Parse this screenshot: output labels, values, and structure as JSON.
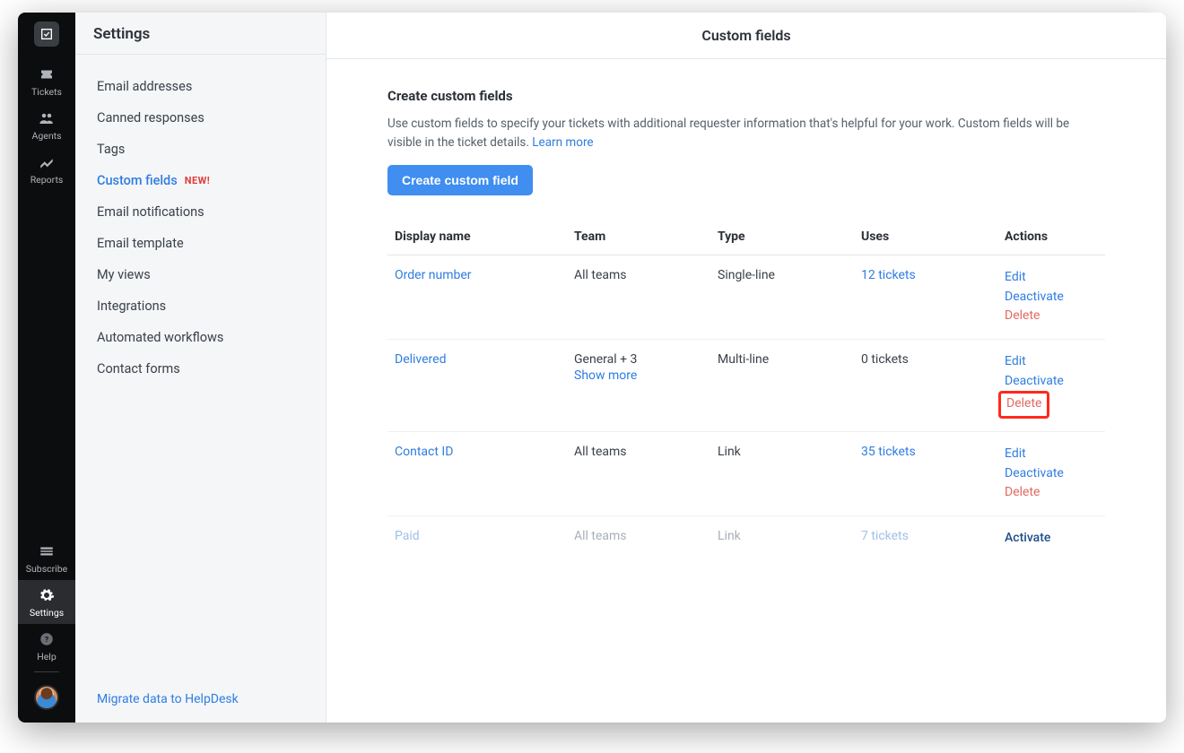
{
  "nav": {
    "items": [
      {
        "label": "Tickets"
      },
      {
        "label": "Agents"
      },
      {
        "label": "Reports"
      }
    ],
    "bottom": [
      {
        "label": "Subscribe"
      },
      {
        "label": "Settings"
      },
      {
        "label": "Help"
      }
    ]
  },
  "sidebar": {
    "title": "Settings",
    "items": [
      {
        "label": "Email addresses"
      },
      {
        "label": "Canned responses"
      },
      {
        "label": "Tags"
      },
      {
        "label": "Custom fields",
        "badge": "NEW!"
      },
      {
        "label": "Email notifications"
      },
      {
        "label": "Email template"
      },
      {
        "label": "My views"
      },
      {
        "label": "Integrations"
      },
      {
        "label": "Automated workflows"
      },
      {
        "label": "Contact forms"
      }
    ],
    "footer_link": "Migrate data to HelpDesk"
  },
  "main": {
    "header": "Custom fields",
    "section_title": "Create custom fields",
    "section_desc": "Use custom fields to specify your tickets with additional requester information that's helpful for your work. Custom fields will be visible in the ticket details. ",
    "learn_more": "Learn more",
    "create_button": "Create custom field",
    "table": {
      "headers": {
        "name": "Display name",
        "team": "Team",
        "type": "Type",
        "uses": "Uses",
        "actions": "Actions"
      },
      "rows": [
        {
          "name": "Order number",
          "team": "All teams",
          "team_more": "",
          "type": "Single-line",
          "uses": "12 tickets",
          "uses_is_link": true,
          "actions": [
            "Edit",
            "Deactivate",
            "Delete"
          ],
          "inactive": false,
          "highlight_delete": false
        },
        {
          "name": "Delivered",
          "team": "General + 3",
          "team_more": "Show more",
          "type": "Multi-line",
          "uses": "0 tickets",
          "uses_is_link": false,
          "actions": [
            "Edit",
            "Deactivate",
            "Delete"
          ],
          "inactive": false,
          "highlight_delete": true
        },
        {
          "name": "Contact ID",
          "team": "All teams",
          "team_more": "",
          "type": "Link",
          "uses": "35 tickets",
          "uses_is_link": true,
          "actions": [
            "Edit",
            "Deactivate",
            "Delete"
          ],
          "inactive": false,
          "highlight_delete": false
        },
        {
          "name": "Paid",
          "team": "All teams",
          "team_more": "",
          "type": "Link",
          "uses": "7 tickets",
          "uses_is_link": true,
          "actions": [
            "Activate"
          ],
          "inactive": true,
          "highlight_delete": false
        }
      ]
    }
  }
}
